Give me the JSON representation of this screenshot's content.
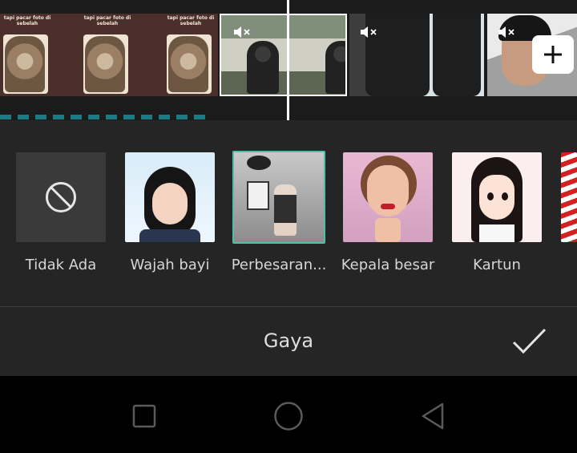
{
  "timeline": {
    "clips": [
      {
        "type": "sloth-meme",
        "caption": "tapi pacar foto di sebelah"
      },
      {
        "type": "sloth-meme",
        "caption": "tapi pacar foto di sebelah"
      },
      {
        "type": "sloth-meme",
        "caption": "tapi pacar foto di sebelah"
      },
      {
        "type": "street-video",
        "muted": true
      },
      {
        "type": "shirt-video",
        "muted": true
      },
      {
        "type": "selfie-video",
        "muted": true
      }
    ],
    "add_button_icon": "plus-icon",
    "colors": {
      "accent": "#17a4b4",
      "selected_border": "#ffffff"
    }
  },
  "effects": {
    "selected_index": 2,
    "items": [
      {
        "label": "Tidak Ada",
        "icon": "no-effect-icon"
      },
      {
        "label": "Wajah bayi"
      },
      {
        "label": "Perbesaran..."
      },
      {
        "label": "Kepala besar"
      },
      {
        "label": "Kartun"
      }
    ],
    "selected_color": "#4fbfa9"
  },
  "bottom_bar": {
    "title": "Gaya",
    "confirm_icon": "checkmark-icon"
  },
  "system_nav": {
    "buttons": [
      "recent-apps-icon",
      "home-icon",
      "back-icon"
    ]
  }
}
